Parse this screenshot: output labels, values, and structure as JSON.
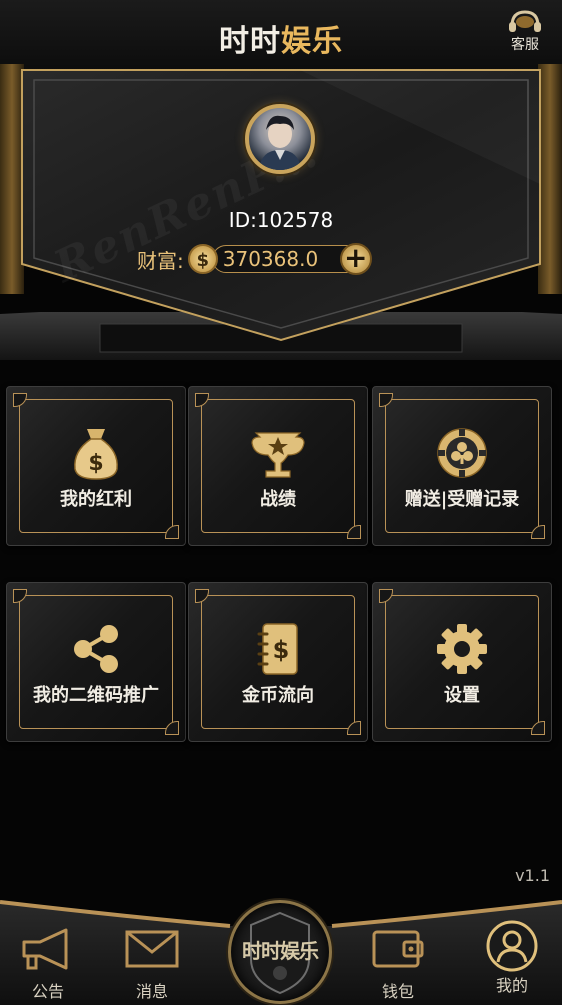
{
  "header": {
    "title_part1": "时时",
    "title_part2": "娱乐",
    "service_label": "客服",
    "service_icon": "headset-icon"
  },
  "profile": {
    "watermark": "RenRenP...",
    "user_id": "ID:102578",
    "wealth_label": "财富:",
    "wealth_currency_symbol": "$",
    "wealth_value": "370368.0",
    "add_button_symbol": "+"
  },
  "menu": [
    {
      "label": "我的红利",
      "icon": "money-bag-icon"
    },
    {
      "label": "战绩",
      "icon": "trophy-icon"
    },
    {
      "label": "赠送|受赠记录",
      "icon": "poker-chip-icon"
    },
    {
      "label": "我的二维码推广",
      "icon": "share-icon"
    },
    {
      "label": "金币流向",
      "icon": "notebook-dollar-icon"
    },
    {
      "label": "设置",
      "icon": "gear-icon"
    }
  ],
  "version": "v1.1",
  "bottom_nav": {
    "items": [
      {
        "label": "公告",
        "icon": "megaphone-icon"
      },
      {
        "label": "消息",
        "icon": "envelope-icon"
      },
      {
        "label": "钱包",
        "icon": "wallet-icon"
      },
      {
        "label": "我的",
        "icon": "user-icon"
      }
    ],
    "center_logo_text": "时时娱乐"
  },
  "colors": {
    "gold": "#c9a45c",
    "background": "#050505"
  }
}
